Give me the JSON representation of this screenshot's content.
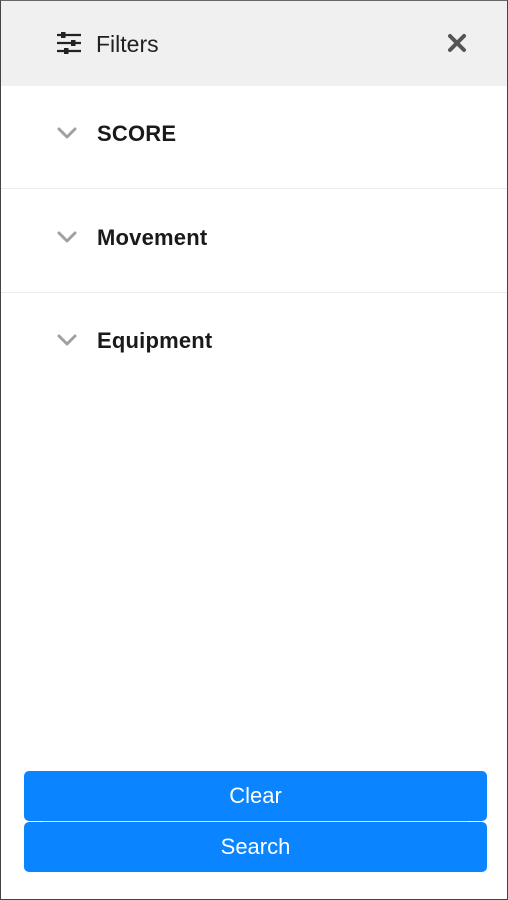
{
  "header": {
    "title": "Filters",
    "icon": "sliders-icon",
    "close_icon": "close-icon"
  },
  "sections": [
    {
      "label": "SCORE",
      "icon": "chevron-down-icon"
    },
    {
      "label": "Movement",
      "icon": "chevron-down-icon"
    },
    {
      "label": "Equipment",
      "icon": "chevron-down-icon"
    }
  ],
  "actions": {
    "clear_label": "Clear",
    "search_label": "Search"
  },
  "colors": {
    "accent": "#0a84ff",
    "header_bg": "#f0f0f0",
    "text": "#1a1a1a",
    "chevron": "#a0a0a0"
  }
}
